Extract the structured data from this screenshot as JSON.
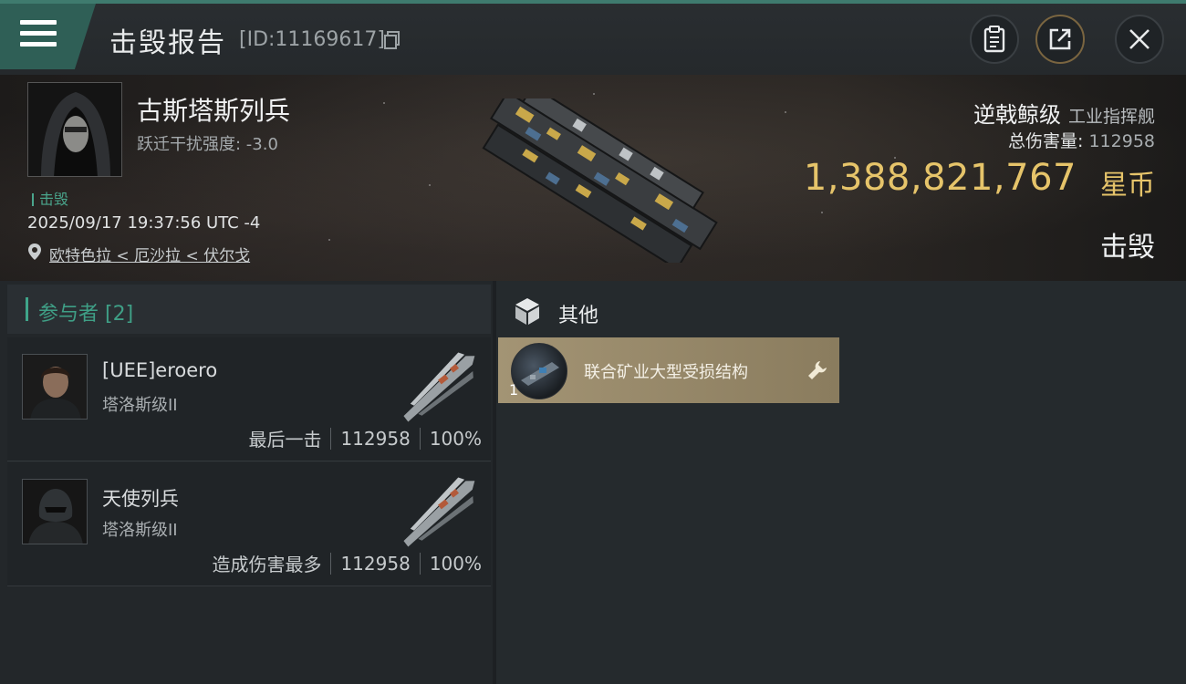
{
  "header": {
    "title": "击毁报告",
    "report_id": "[ID:11169617]"
  },
  "victim": {
    "name": "古斯塔斯列兵",
    "warp_disruption": "跃迁干扰强度: -3.0",
    "status_tag": "击毁",
    "timestamp": "2025/09/17 19:37:56 UTC -4",
    "location": "欧特色拉 < 厄沙拉 < 伏尔戈"
  },
  "ship": {
    "name": "逆戟鲸级",
    "class": "工业指挥舰",
    "damage_label": "总伤害量:",
    "damage_value": "112958",
    "isk_value": "1,388,821,767",
    "isk_unit": "星币",
    "result": "击毁"
  },
  "participants": {
    "title": "参与者 [2]",
    "items": [
      {
        "name": "[UEE]eroero",
        "ship": "塔洛斯级II",
        "role": "最后一击",
        "damage": "112958",
        "percent": "100%"
      },
      {
        "name": "天使列兵",
        "ship": "塔洛斯级II",
        "role": "造成伤害最多",
        "damage": "112958",
        "percent": "100%"
      }
    ]
  },
  "other": {
    "title": "其他",
    "items": [
      {
        "name": "联合矿业大型受损结构",
        "quantity": "1"
      }
    ]
  },
  "icons": {
    "menu": "menu-icon",
    "copy": "copy-icon",
    "clipboard": "clipboard-icon",
    "share": "share-icon",
    "close": "close-icon",
    "location": "location-pin-icon",
    "cube": "cube-icon",
    "wrench": "wrench-icon"
  },
  "colors": {
    "accent_green": "#3fa58a",
    "isk_gold": "#e6c46a",
    "item_card": "#a39474"
  }
}
